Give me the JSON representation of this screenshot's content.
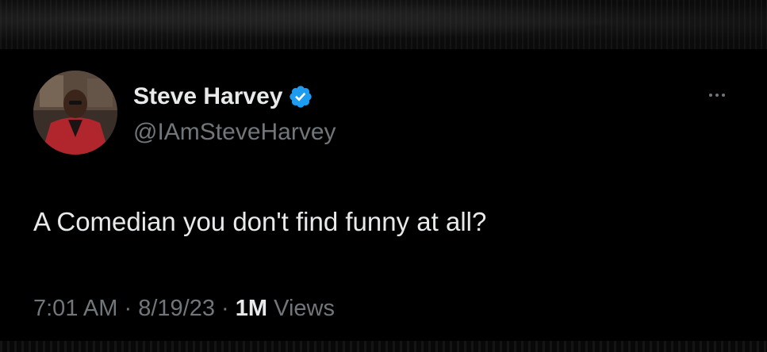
{
  "author": {
    "display_name": "Steve Harvey",
    "handle": "@IAmSteveHarvey",
    "verified": true
  },
  "tweet": {
    "text": "A Comedian you don't find funny at all?",
    "time": "7:01 AM",
    "separator": "·",
    "date": "8/19/23",
    "views_count": "1M",
    "views_label": "Views"
  },
  "icons": {
    "verified": "verified-badge-icon",
    "more": "more-options-icon"
  },
  "colors": {
    "background": "#000000",
    "primary_text": "#e7e9ea",
    "secondary_text": "#71767b",
    "verified_blue": "#1d9bf0"
  }
}
